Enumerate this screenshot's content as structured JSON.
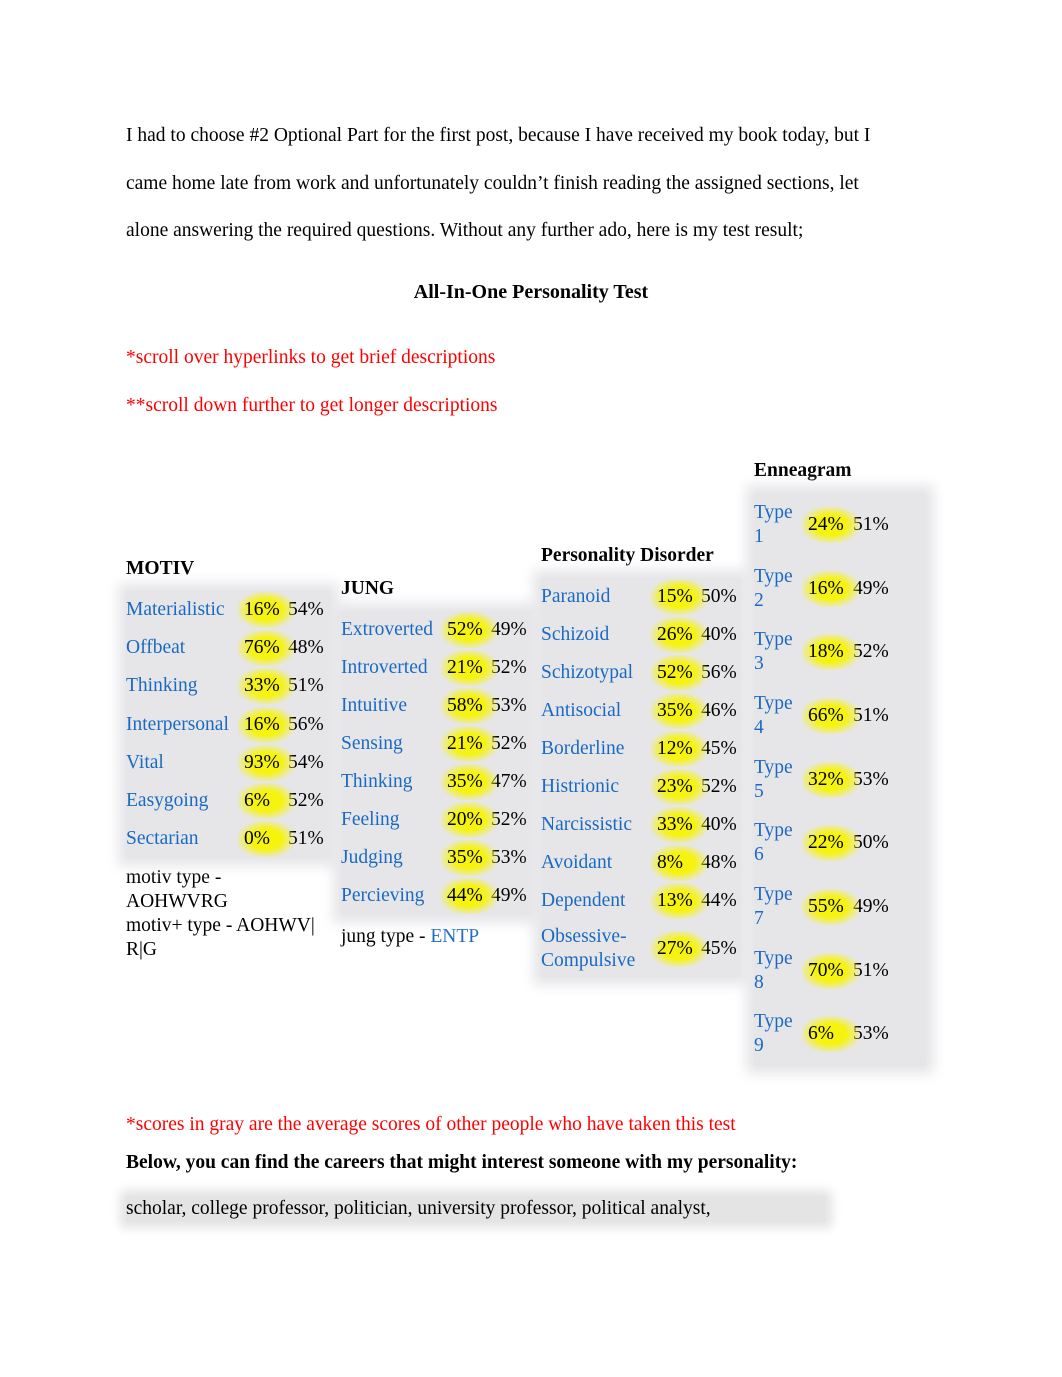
{
  "intro": {
    "lines": [
      "I had to choose #2 Optional Part for the first post, because I have received my book today, but I",
      "came home late from work and unfortunately couldn’t finish reading the assigned sections, let",
      "alone answering the required questions. Without any further ado, here is my test result;"
    ]
  },
  "title": "All-In-One Personality Test",
  "notes": {
    "hyperlinks": "*scroll over hyperlinks to get brief descriptions",
    "scroll": "**scroll down further to get longer descriptions"
  },
  "colors": {
    "link": "#1a6ac3",
    "note_red": "#ff0000",
    "highlight_yellow": "#f6f30f",
    "table_gray": "#e6e6e9"
  },
  "motiv": {
    "heading": "MOTIV",
    "rows": [
      {
        "label": "Materialistic",
        "score": "16%",
        "avg": "54%"
      },
      {
        "label": "Offbeat",
        "score": "76%",
        "avg": "48%"
      },
      {
        "label": "Thinking",
        "score": "33%",
        "avg": "51%"
      },
      {
        "label": "Interpersonal",
        "score": "16%",
        "avg": "56%"
      },
      {
        "label": "Vital",
        "score": "93%",
        "avg": "54%"
      },
      {
        "label": "Easygoing",
        "score": "6%",
        "avg": "52%"
      },
      {
        "label": "Sectarian",
        "score": "0%",
        "avg": "51%"
      }
    ],
    "type_line1": "motiv type -",
    "type_line2": "AOHWVRG",
    "plus_line1": "motiv+ type - AOHWV|",
    "plus_line2": "R|G"
  },
  "jung": {
    "heading": "JUNG",
    "rows": [
      {
        "label": "Extroverted",
        "score": "52%",
        "avg": "49%"
      },
      {
        "label": "Introverted",
        "score": "21%",
        "avg": "52%"
      },
      {
        "label": "Intuitive",
        "score": "58%",
        "avg": "53%"
      },
      {
        "label": "Sensing",
        "score": "21%",
        "avg": "52%"
      },
      {
        "label": "Thinking",
        "score": "35%",
        "avg": "47%"
      },
      {
        "label": "Feeling",
        "score": "20%",
        "avg": "52%"
      },
      {
        "label": "Judging",
        "score": "35%",
        "avg": "53%"
      },
      {
        "label": "Percieving",
        "score": "44%",
        "avg": "49%"
      }
    ],
    "type_prefix": "jung type - ",
    "type_value": "ENTP"
  },
  "disorder": {
    "heading": "Personality Disorder",
    "rows": [
      {
        "label": "Paranoid",
        "score": "15%",
        "avg": "50%"
      },
      {
        "label": "Schizoid",
        "score": "26%",
        "avg": "40%"
      },
      {
        "label": "Schizotypal",
        "score": "52%",
        "avg": "56%"
      },
      {
        "label": "Antisocial",
        "score": "35%",
        "avg": "46%"
      },
      {
        "label": "Borderline",
        "score": "12%",
        "avg": "45%"
      },
      {
        "label": "Histrionic",
        "score": "23%",
        "avg": "52%"
      },
      {
        "label": "Narcissistic",
        "score": "33%",
        "avg": "40%"
      },
      {
        "label": "Avoidant",
        "score": "8%",
        "avg": "48%"
      },
      {
        "label": "Dependent",
        "score": "13%",
        "avg": "44%"
      },
      {
        "label": "Obsessive-Compulsive",
        "label_line1": "Obsessive-",
        "label_line2": "Compulsive",
        "score": "27%",
        "avg": "45%"
      }
    ]
  },
  "enneagram": {
    "heading": "Enneagram",
    "rows": [
      {
        "label_word": "Type",
        "label_num": "1",
        "score": "24%",
        "avg": "51%"
      },
      {
        "label_word": "Type",
        "label_num": "2",
        "score": "16%",
        "avg": "49%"
      },
      {
        "label_word": "Type",
        "label_num": "3",
        "score": "18%",
        "avg": "52%"
      },
      {
        "label_word": "Type",
        "label_num": "4",
        "score": "66%",
        "avg": "51%"
      },
      {
        "label_word": "Type",
        "label_num": "5",
        "score": "32%",
        "avg": "53%"
      },
      {
        "label_word": "Type",
        "label_num": "6",
        "score": "22%",
        "avg": "50%"
      },
      {
        "label_word": "Type",
        "label_num": "7",
        "score": "55%",
        "avg": "49%"
      },
      {
        "label_word": "Type",
        "label_num": "8",
        "score": "70%",
        "avg": "51%"
      },
      {
        "label_word": "Type",
        "label_num": "9",
        "score": "6%",
        "avg": "53%"
      }
    ]
  },
  "footnote": "*scores in gray are the average scores of other people who have taken this test",
  "careers": {
    "heading": "Below, you can find the careers that might interest someone with my personality:",
    "list": "scholar, college professor, politician, university professor, political analyst,"
  }
}
